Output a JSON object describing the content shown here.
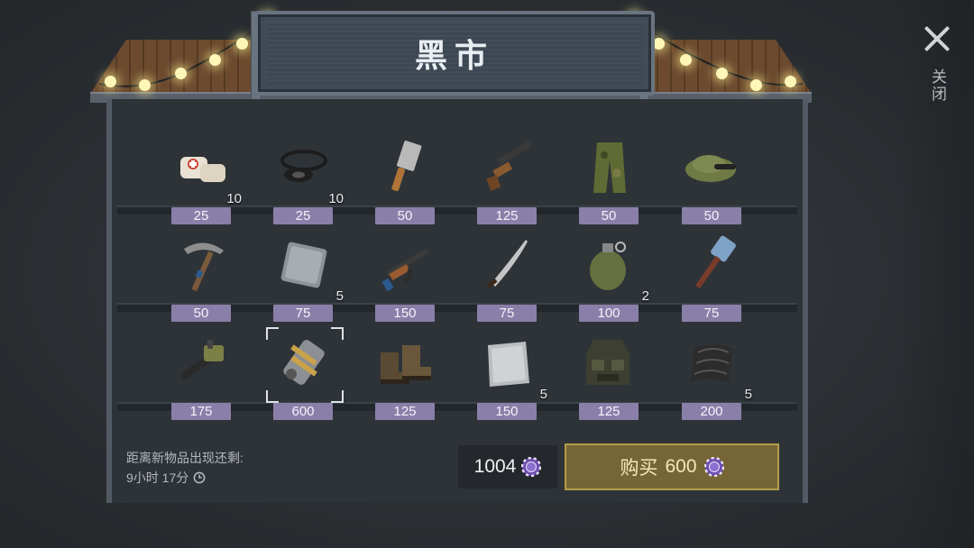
{
  "header": {
    "title": "黑市"
  },
  "close": {
    "label": "关闭"
  },
  "items": [
    {
      "name": "bandages",
      "price": "25",
      "qty": "10"
    },
    {
      "name": "rubber-seals",
      "price": "25",
      "qty": "10"
    },
    {
      "name": "cleaver",
      "price": "50",
      "qty": ""
    },
    {
      "name": "sawed-off-shotgun",
      "price": "125",
      "qty": ""
    },
    {
      "name": "camo-pants",
      "price": "50",
      "qty": ""
    },
    {
      "name": "camo-cap",
      "price": "50",
      "qty": ""
    },
    {
      "name": "pickaxe",
      "price": "50",
      "qty": ""
    },
    {
      "name": "steel-plate",
      "price": "75",
      "qty": "5"
    },
    {
      "name": "assault-rifle",
      "price": "150",
      "qty": ""
    },
    {
      "name": "machete",
      "price": "75",
      "qty": ""
    },
    {
      "name": "grenade",
      "price": "100",
      "qty": "2"
    },
    {
      "name": "sledgehammer",
      "price": "75",
      "qty": ""
    },
    {
      "name": "chainsaw",
      "price": "175",
      "qty": ""
    },
    {
      "name": "engine-part",
      "price": "600",
      "qty": ""
    },
    {
      "name": "boots",
      "price": "125",
      "qty": ""
    },
    {
      "name": "metal-sheet",
      "price": "150",
      "qty": "5"
    },
    {
      "name": "tactical-vest",
      "price": "125",
      "qty": ""
    },
    {
      "name": "rubber-mat",
      "price": "200",
      "qty": "5"
    }
  ],
  "footer": {
    "timer_label": "距离新物品出现还剩:",
    "timer_value": "9小时 17分",
    "balance": "1004",
    "buy_label": "购买",
    "buy_price": "600"
  },
  "selected_item": "engine-part",
  "colors": {
    "price_tag": "#8a7fa9",
    "buy_button": "#776635",
    "buy_border": "#b29c49",
    "currency_chip": "#6d4fb0"
  }
}
